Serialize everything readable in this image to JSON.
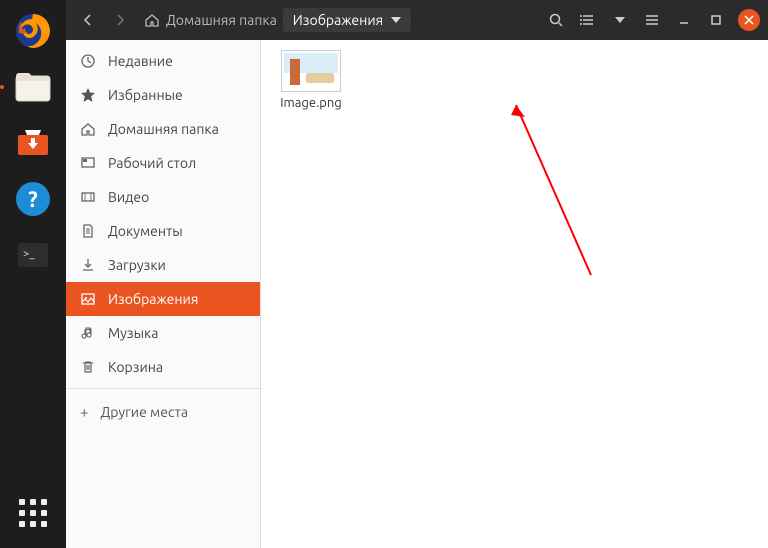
{
  "breadcrumb": {
    "home": "Домашняя папка",
    "current": "Изображения"
  },
  "sidebar": {
    "items": [
      {
        "label": "Недавние"
      },
      {
        "label": "Избранные"
      },
      {
        "label": "Домашняя папка"
      },
      {
        "label": "Рабочий стол"
      },
      {
        "label": "Видео"
      },
      {
        "label": "Документы"
      },
      {
        "label": "Загрузки"
      },
      {
        "label": "Изображения"
      },
      {
        "label": "Музыка"
      },
      {
        "label": "Корзина"
      }
    ],
    "other": "Другие места"
  },
  "files": [
    {
      "name": "Image.png"
    }
  ]
}
